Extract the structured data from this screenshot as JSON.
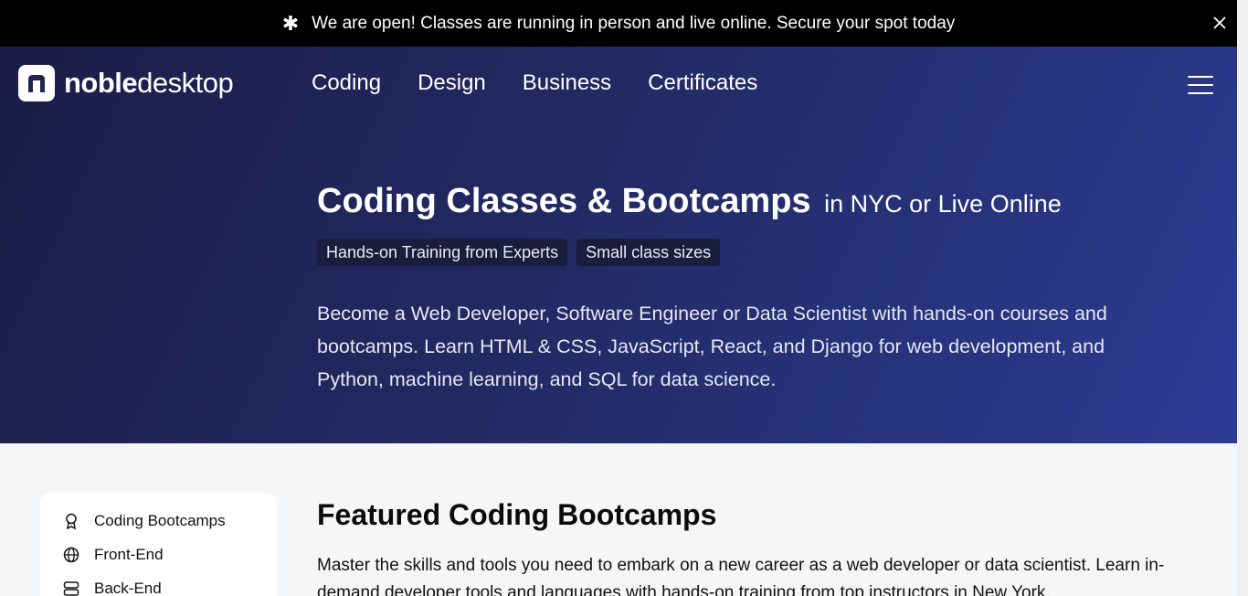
{
  "announcement": {
    "icon": "asterisk-icon",
    "text": "We are open! Classes are running in person and live online. Secure your spot today",
    "close_icon": "close-icon"
  },
  "header": {
    "logo_word1": "noble",
    "logo_word2": "desktop",
    "nav": [
      "Coding",
      "Design",
      "Business",
      "Certificates"
    ],
    "menu_icon": "hamburger-menu-icon"
  },
  "hero": {
    "title": "Coding Classes & Bootcamps",
    "title_sub": "in NYC or Live Online",
    "pills": [
      "Hands-on Training from Experts",
      "Small class sizes"
    ],
    "description": "Become a Web Developer, Software Engineer or Data Scientist with hands-on courses and bootcamps. Learn HTML & CSS, JavaScript, React, and Django for web development, and Python, machine learning, and SQL for data science."
  },
  "sidebar": {
    "items": [
      {
        "label": "Coding Bootcamps",
        "icon": "award-icon"
      },
      {
        "label": "Front-End",
        "icon": "globe-icon"
      },
      {
        "label": "Back-End",
        "icon": "server-icon"
      }
    ]
  },
  "main": {
    "heading": "Featured Coding Bootcamps",
    "intro": "Master the skills and tools you need to embark on a new career as a web developer or data scientist. Learn in-demand developer tools and languages with hands-on training from top instructors in New York."
  },
  "colors": {
    "announcement_bg": "#000000",
    "hero_start": "#1c1d47",
    "hero_end": "#2c3b93",
    "pill_bg": "#1b1d3c",
    "page_bg": "#f5f6f8"
  }
}
